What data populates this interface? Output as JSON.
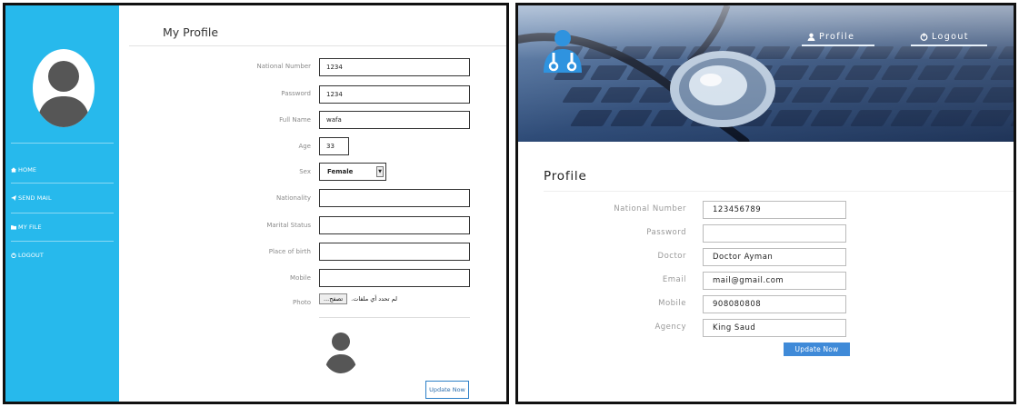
{
  "left": {
    "title": "My Profile",
    "nav": [
      {
        "label": "HOME",
        "icon": "home-icon"
      },
      {
        "label": "SEND MAIL",
        "icon": "send-icon"
      },
      {
        "label": "MY FILE",
        "icon": "folder-icon"
      },
      {
        "label": "LOGOUT",
        "icon": "power-icon"
      }
    ],
    "fields": [
      {
        "label": "National Number",
        "value": "1234"
      },
      {
        "label": "Password",
        "value": "1234"
      },
      {
        "label": "Full Name",
        "value": "wafa"
      },
      {
        "label": "Age",
        "value": "33"
      },
      {
        "label": "Sex",
        "value": "Female"
      },
      {
        "label": "Nationality",
        "value": ""
      },
      {
        "label": "Marital Status",
        "value": ""
      },
      {
        "label": "Place of birth",
        "value": ""
      },
      {
        "label": "Mobile",
        "value": ""
      },
      {
        "label": "Photo",
        "value": ""
      }
    ],
    "browse_label": "تصفح...",
    "no_file_text": "لم تحدد أي ملفات.",
    "update_label": "Update Now",
    "accent": "#27b9ec"
  },
  "right": {
    "nav": [
      {
        "label": "Profile",
        "icon": "user-icon"
      },
      {
        "label": "Logout",
        "icon": "power-icon"
      }
    ],
    "title": "Profile",
    "fields": [
      {
        "label": "National Number",
        "value": "123456789"
      },
      {
        "label": "Password",
        "value": ""
      },
      {
        "label": "Doctor",
        "value": "Doctor Ayman"
      },
      {
        "label": "Email",
        "value": "mail@gmail.com"
      },
      {
        "label": "Mobile",
        "value": "908080808"
      },
      {
        "label": "Agency",
        "value": "King Saud"
      }
    ],
    "update_label": "Update Now",
    "accent": "#3f8ad8"
  }
}
